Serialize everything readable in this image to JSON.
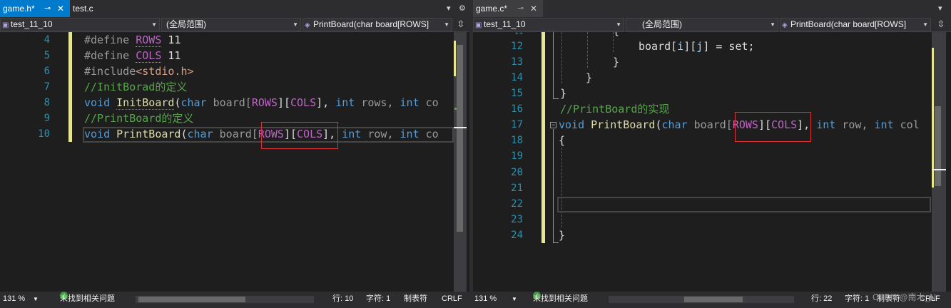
{
  "left_pane": {
    "tabs": [
      {
        "label": "game.h*",
        "pin": "⊸",
        "close": "✕"
      },
      {
        "label": "test.c"
      }
    ],
    "tab_tools": {
      "dropdown": "▾",
      "settings": "⚙"
    },
    "nav": {
      "project": "test_11_10",
      "scope": "(全局范围)",
      "member": "PrintBoard(char board[ROWS]"
    },
    "lines": [
      "4",
      "5",
      "6",
      "7",
      "8",
      "9",
      "10"
    ],
    "status": {
      "zoom": "131 %",
      "issues": "未找到相关问题",
      "line": "行: 10",
      "char": "字符: 1",
      "indent": "制表符",
      "eol": "CRLF"
    }
  },
  "right_pane": {
    "tabs": [
      {
        "label": "game.c*",
        "pin": "⊸",
        "close": "✕"
      }
    ],
    "tab_tools": {
      "dropdown": "▾"
    },
    "nav": {
      "project": "test_11_10",
      "scope": "(全局范围)",
      "member": "PrintBoard(char board[ROWS]"
    },
    "lines": [
      "12",
      "13",
      "14",
      "15",
      "16",
      "17",
      "18",
      "19",
      "20",
      "21",
      "22",
      "23",
      "24"
    ],
    "status": {
      "zoom": "131 %",
      "issues": "未找到相关问题",
      "line": "行: 22",
      "char": "字符: 1",
      "indent": "制表符",
      "eol": "CRLF"
    },
    "watermark": "CSDN @南木_N"
  },
  "code_left": {
    "l4": {
      "pp": "#define ",
      "mac": "ROWS",
      "rest": " 11"
    },
    "l5": {
      "pp": "#define ",
      "mac": "COLS",
      "rest": " 11"
    },
    "l6": {
      "pp": "#include",
      "inc": "<stdio.h>"
    },
    "l7": {
      "cm": "//InitBorad的定义"
    },
    "l8": {
      "kw1": "void",
      "fn": "InitBoard",
      "p1": "(",
      "kw2": "char",
      "t1": " board[",
      "m1": "ROWS",
      "t2": "][",
      "m2": "COLS",
      "t3": "], ",
      "kw3": "int",
      "t4": " rows, ",
      "kw4": "int",
      "t5": " co"
    },
    "l9": {
      "cm": "//PrintBoard的定义"
    },
    "l10": {
      "kw1": "void",
      "fn": "PrintBoard",
      "p1": "(",
      "kw2": "char",
      "t1": " board[",
      "m1": "ROWS",
      "t2": "][",
      "m2": "COLS",
      "t3": "], ",
      "kw3": "int",
      "t4": " row, ",
      "kw4": "int",
      "t5": " co"
    }
  },
  "code_right": {
    "l12": {
      "t1": "board[",
      "v1": "i",
      "t2": "][",
      "v2": "j",
      "t3": "] = set;"
    },
    "l13": {
      "t": "}"
    },
    "l14": {
      "t": "}"
    },
    "l15": {
      "t": "}"
    },
    "l16": {
      "cm": "//PrintBoard的实现"
    },
    "l17": {
      "kw1": "void",
      "fn": "PrintBoard",
      "p1": "(",
      "kw2": "char",
      "t1": " board[",
      "m1": "ROWS",
      "t2": "][",
      "m2": "COLS",
      "t3": "], ",
      "kw3": "int",
      "t4": " row, ",
      "kw4": "int",
      "t5": " col"
    },
    "l18": {
      "t": "{"
    },
    "l24": {
      "t": "}"
    },
    "l11_partial": {
      "t": "{"
    }
  },
  "colors": {
    "accent": "#007acc",
    "highlight": "#e03030",
    "changed": "#e6e68e"
  }
}
